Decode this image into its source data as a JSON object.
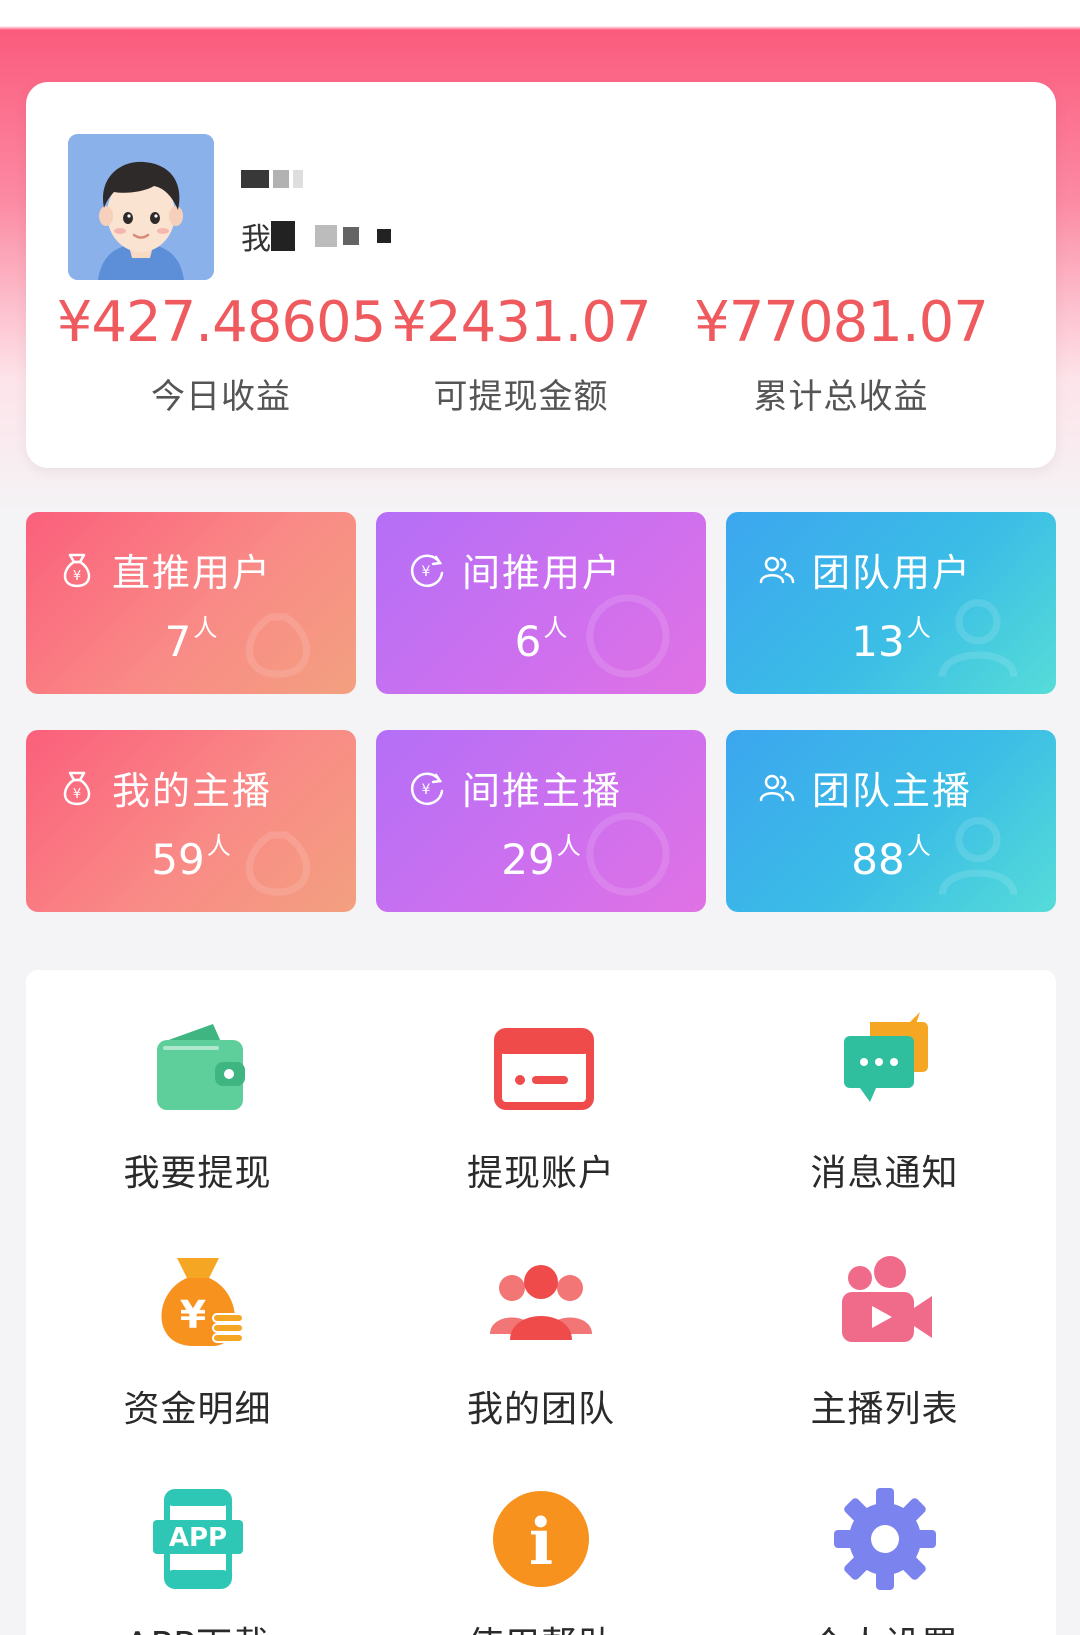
{
  "user": {
    "sub_prefix": "我"
  },
  "stats": [
    {
      "value": "¥427.48605",
      "label": "今日收益"
    },
    {
      "value": "¥2431.07",
      "label": "可提现金额"
    },
    {
      "value": "¥77081.07",
      "label": "累计总收益"
    }
  ],
  "tiles": [
    {
      "title": "直推用户",
      "count": "7",
      "unit": "人",
      "color": "#fb5f7c",
      "icon": "money-bag-icon"
    },
    {
      "title": "间推用户",
      "count": "6",
      "unit": "人",
      "color": "#b46ff6",
      "icon": "yuan-refresh-icon"
    },
    {
      "title": "团队用户",
      "count": "13",
      "unit": "人",
      "color": "#3ca6ef",
      "icon": "team-users-icon"
    },
    {
      "title": "我的主播",
      "count": "59",
      "unit": "人",
      "color": "#fb5f7c",
      "icon": "money-bag-icon"
    },
    {
      "title": "间推主播",
      "count": "29",
      "unit": "人",
      "color": "#b46ff6",
      "icon": "yuan-refresh-icon"
    },
    {
      "title": "团队主播",
      "count": "88",
      "unit": "人",
      "color": "#3ca6ef",
      "icon": "team-users-icon"
    }
  ],
  "menu": [
    {
      "label": "我要提现",
      "icon": "wallet-icon",
      "color": "#5ecf9a"
    },
    {
      "label": "提现账户",
      "icon": "bank-card-icon",
      "color": "#ef4b4b"
    },
    {
      "label": "消息通知",
      "icon": "chat-bubbles-icon",
      "color": "#2fbf9e"
    },
    {
      "label": "资金明细",
      "icon": "money-bag-icon",
      "color": "#f5a623"
    },
    {
      "label": "我的团队",
      "icon": "team-icon",
      "color": "#ef4b4b"
    },
    {
      "label": "主播列表",
      "icon": "video-camera-icon",
      "color": "#f06a8a"
    },
    {
      "label": "APP下载",
      "icon": "app-download-icon",
      "color": "#2ec7b5",
      "icon_text": "APP"
    },
    {
      "label": "使用帮助",
      "icon": "info-icon",
      "color": "#f5a623",
      "icon_text": "i"
    },
    {
      "label": "个人设置",
      "icon": "gear-icon",
      "color": "#7b83ef"
    }
  ]
}
